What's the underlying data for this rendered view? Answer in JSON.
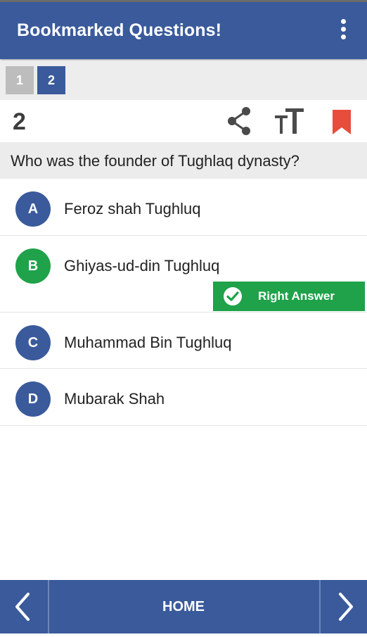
{
  "app": {
    "title": "Bookmarked Questions!",
    "accent": "#3a5a9b",
    "correct_color": "#1fa24a",
    "bookmark_color": "#e74c3c"
  },
  "pager": {
    "pages": [
      "1",
      "2"
    ],
    "current": "2"
  },
  "question": {
    "number": "2",
    "text": "Who was the founder of Tughlaq dynasty?",
    "icons": [
      "share-icon",
      "text-size-icon",
      "bookmark-icon"
    ]
  },
  "options": [
    {
      "letter": "A",
      "text": "Feroz shah Tughluq"
    },
    {
      "letter": "B",
      "text": "Ghiyas-ud-din Tughluq",
      "correct": true
    },
    {
      "letter": "C",
      "text": "Muhammad Bin Tughluq"
    },
    {
      "letter": "D",
      "text": "Mubarak Shah"
    }
  ],
  "right_answer_label": "Right Answer",
  "bottom": {
    "home_label": "HOME",
    "prev_icon": "chevron-left-icon",
    "next_icon": "chevron-right-icon"
  }
}
